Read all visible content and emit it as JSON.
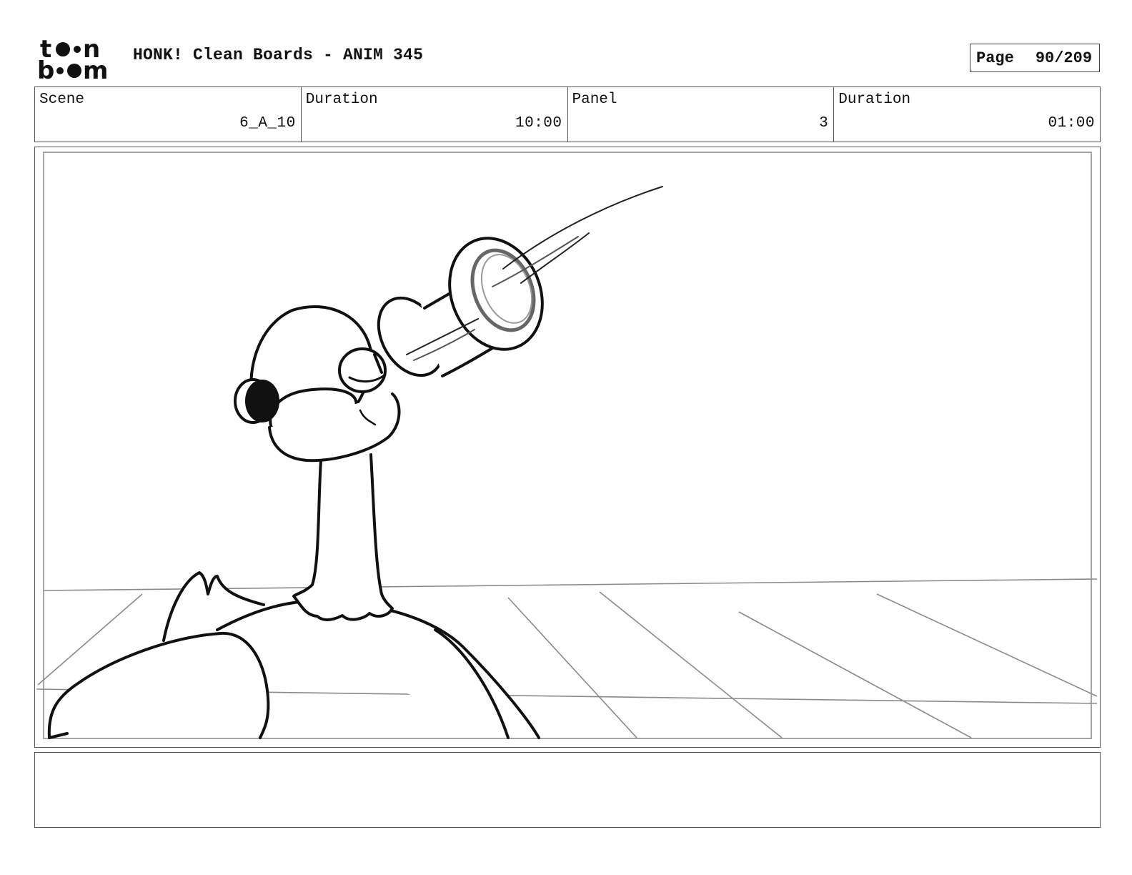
{
  "header": {
    "logo_icon": "toon-boom-logo",
    "title": "HONK! Clean Boards - ANIM 345",
    "page_label": "Page",
    "page_value": "90/209"
  },
  "info": {
    "scene_label": "Scene",
    "scene_value": "6_A_10",
    "scene_duration_label": "Duration",
    "scene_duration_value": "10:00",
    "panel_label": "Panel",
    "panel_value": "3",
    "panel_duration_label": "Duration",
    "panel_duration_value": "01:00"
  },
  "panel": {
    "image": "goose-holding-telescope-sketch"
  },
  "notes": {
    "text": ""
  }
}
